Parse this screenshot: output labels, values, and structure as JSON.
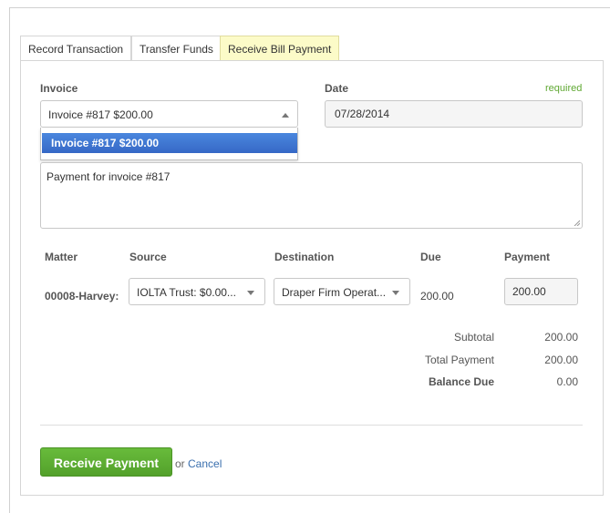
{
  "tabs": [
    {
      "label": "Record Transaction"
    },
    {
      "label": "Transfer Funds"
    },
    {
      "label": "Receive Bill Payment"
    }
  ],
  "form": {
    "invoice_label": "Invoice",
    "invoice_value": "Invoice #817 $200.00",
    "invoice_option": "Invoice #817 $200.00",
    "date_label": "Date",
    "date_value": "07/28/2014",
    "required_label": "required",
    "memo_value": "Payment for invoice #817"
  },
  "table": {
    "headers": {
      "matter": "Matter",
      "source": "Source",
      "destination": "Destination",
      "due": "Due",
      "payment": "Payment"
    },
    "row": {
      "matter": "00008-Harvey:",
      "source": "IOLTA Trust: $0.00...",
      "destination": "Draper Firm Operat...",
      "due": "200.00",
      "payment": "200.00"
    }
  },
  "summary": {
    "subtotal_label": "Subtotal",
    "subtotal_value": "200.00",
    "total_label": "Total Payment",
    "total_value": "200.00",
    "balance_label": "Balance Due",
    "balance_value": "0.00"
  },
  "actions": {
    "receive_label": "Receive Payment",
    "or_text": "or",
    "cancel_label": "Cancel"
  },
  "colors": {
    "active_tab": "#fcfbc8",
    "primary_button": "#5fb033",
    "selected_option": "#3875d7",
    "required": "#5fa832",
    "link": "#3a6fae"
  }
}
